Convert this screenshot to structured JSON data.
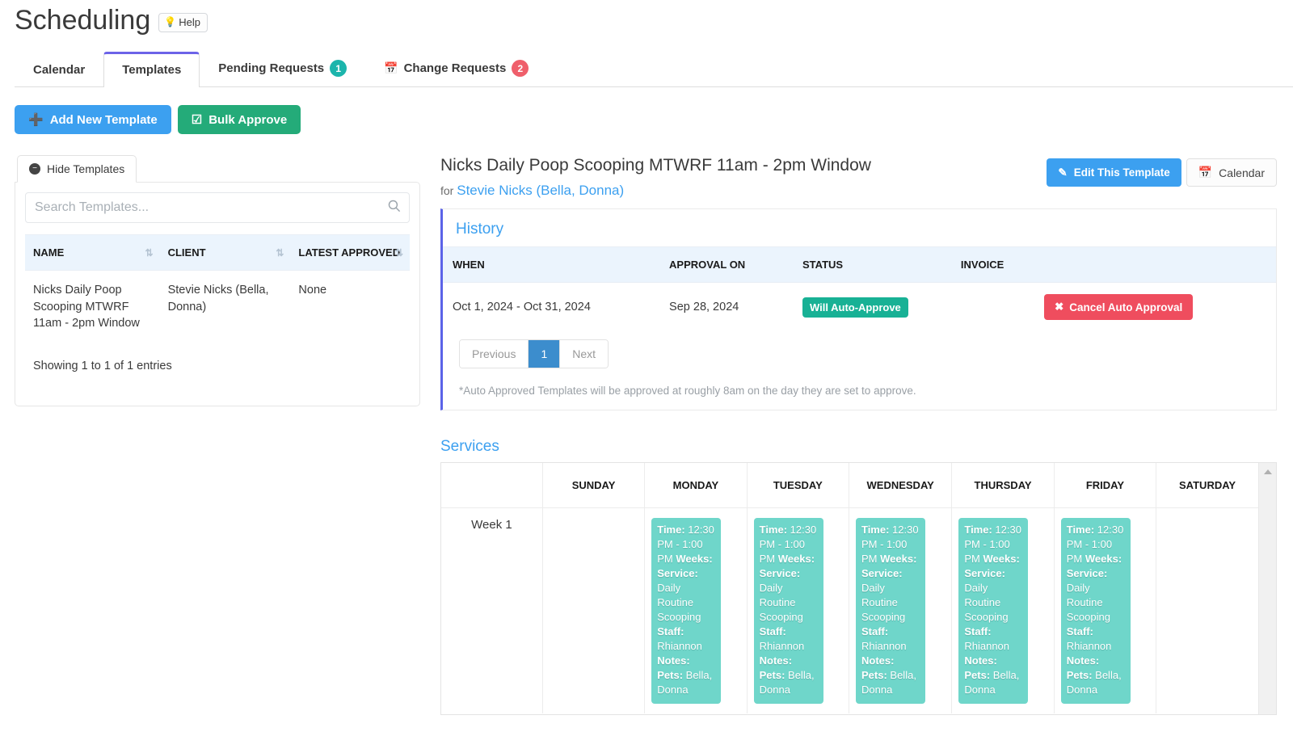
{
  "header": {
    "title": "Scheduling",
    "help_label": "Help",
    "help_icon": "lightbulb-icon"
  },
  "tabs": [
    {
      "label": "Calendar",
      "badge": null,
      "badge_color": null,
      "icon": null,
      "active": false
    },
    {
      "label": "Templates",
      "badge": null,
      "badge_color": null,
      "icon": null,
      "active": true
    },
    {
      "label": "Pending Requests",
      "badge": "1",
      "badge_color": "#1cb5ac",
      "icon": null,
      "active": false
    },
    {
      "label": "Change Requests",
      "badge": "2",
      "badge_color": "#ef5f6b",
      "icon": "calendar-icon",
      "active": false
    }
  ],
  "actions": {
    "add_new_template": "Add New Template",
    "add_icon": "plus-circle-icon",
    "bulk_approve": "Bulk Approve",
    "bulk_icon": "checkbox-checked-icon"
  },
  "templates_panel": {
    "toggle_label": "Hide Templates",
    "toggle_icon": "minus-circle-icon",
    "search_placeholder": "Search Templates...",
    "search_value": "",
    "search_icon": "search-icon",
    "columns": [
      "NAME",
      "CLIENT",
      "LATEST APPROVED"
    ],
    "rows": [
      {
        "name": "Nicks Daily Poop Scooping MTWRF 11am - 2pm Window",
        "client": "Stevie Nicks (Bella, Donna)",
        "latest_approved": "None"
      }
    ],
    "showing": "Showing 1 to 1 of 1 entries"
  },
  "detail": {
    "title": "Nicks Daily Poop Scooping MTWRF 11am - 2pm Window",
    "for_prefix": "for",
    "client_link": "Stevie Nicks (Bella, Donna)",
    "edit_button": "Edit This Template",
    "edit_icon": "pencil-square-icon",
    "calendar_button": "Calendar",
    "calendar_icon": "calendar-icon"
  },
  "history": {
    "title": "History",
    "columns": [
      "WHEN",
      "APPROVAL ON",
      "STATUS",
      "INVOICE",
      ""
    ],
    "rows": [
      {
        "when": "Oct 1, 2024 - Oct 31, 2024",
        "approval_on": "Sep 28, 2024",
        "status": "Will Auto-Approve",
        "status_color": "#18b195",
        "invoice": "",
        "action": "Cancel Auto Approval",
        "action_icon": "cancel-circle-icon",
        "action_color": "#ef4d5e"
      }
    ],
    "pagination": {
      "previous": "Previous",
      "pages": [
        "1"
      ],
      "current": "1",
      "next": "Next"
    },
    "footnote": "*Auto Approved Templates will be approved at roughly 8am on the day they are set to approve."
  },
  "services": {
    "title": "Services",
    "columns": [
      "",
      "SUNDAY",
      "MONDAY",
      "TUESDAY",
      "WEDNESDAY",
      "THURSDAY",
      "FRIDAY",
      "SATURDAY"
    ],
    "week_label": "Week 1",
    "card_labels": {
      "time": "Time:",
      "weeks": "Weeks:",
      "service": "Service:",
      "staff": "Staff:",
      "notes": "Notes:",
      "pets": "Pets:"
    },
    "cells": [
      null,
      {
        "time": "12:30 PM - 1:00 PM",
        "weeks": "",
        "service": "Daily Routine Scooping",
        "staff": "Rhiannon",
        "notes": "",
        "pets": "Bella, Donna"
      },
      {
        "time": "12:30 PM - 1:00 PM",
        "weeks": "",
        "service": "Daily Routine Scooping",
        "staff": "Rhiannon",
        "notes": "",
        "pets": "Bella, Donna"
      },
      {
        "time": "12:30 PM - 1:00 PM",
        "weeks": "",
        "service": "Daily Routine Scooping",
        "staff": "Rhiannon",
        "notes": "",
        "pets": "Bella, Donna"
      },
      {
        "time": "12:30 PM - 1:00 PM",
        "weeks": "",
        "service": "Daily Routine Scooping",
        "staff": "Rhiannon",
        "notes": "",
        "pets": "Bella, Donna"
      },
      {
        "time": "12:30 PM - 1:00 PM",
        "weeks": "",
        "service": "Daily Routine Scooping",
        "staff": "Rhiannon",
        "notes": "",
        "pets": "Bella, Donna"
      },
      null
    ],
    "card_color": "#6fd6ca"
  }
}
